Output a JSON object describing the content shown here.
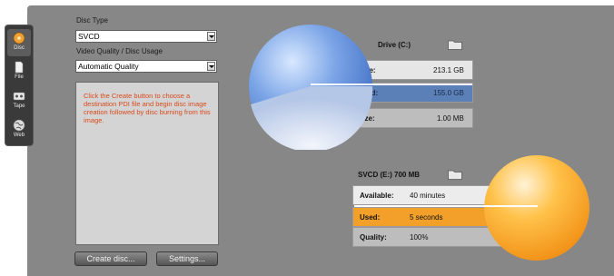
{
  "sidebar": {
    "tabs": [
      {
        "label": "Disc",
        "icon": "disc-icon",
        "active": true
      },
      {
        "label": "File",
        "icon": "file-icon",
        "active": false
      },
      {
        "label": "Tape",
        "icon": "tape-icon",
        "active": false
      },
      {
        "label": "Web",
        "icon": "web-icon",
        "active": false
      }
    ]
  },
  "settings": {
    "disc_type_label": "Disc Type",
    "disc_type_value": "SVCD",
    "quality_label": "Video Quality / Disc Usage",
    "quality_value": "Automatic Quality",
    "info_text": "Click the Create button to choose a destination PDI file and begin disc image creation followed by disc burning from this image."
  },
  "buttons": {
    "create_disc": "Create disc...",
    "settings": "Settings..."
  },
  "drive": {
    "title": "Drive (C:)",
    "free_label": "Free:",
    "free_value": "213.1 GB",
    "used_label": "Used:",
    "used_value": "155.0 GB",
    "size_label": "Size:",
    "size_value": "1.00 MB"
  },
  "disc": {
    "title": "SVCD (E:) 700 MB",
    "available_label": "Available:",
    "available_value": "40 minutes",
    "used_label": "Used:",
    "used_value": "5 seconds",
    "quality_label": "Quality:",
    "quality_value": "100%"
  },
  "colors": {
    "panel": "#878787",
    "drive_used_row": "#5b80b8",
    "disc_used_row": "#f2a02a",
    "info_text": "#d94a1c"
  }
}
